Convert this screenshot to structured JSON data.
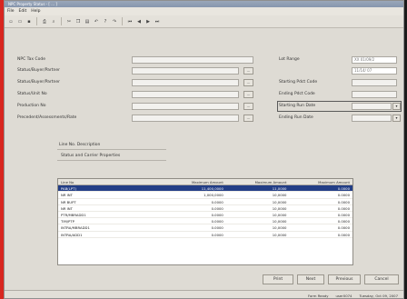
{
  "window": {
    "title": "NPC Property Status - [ ... ]"
  },
  "menu": {
    "items": [
      "File",
      "Edit",
      "Help"
    ]
  },
  "toolbar": {
    "icons": [
      "new-icon",
      "open-icon",
      "save-icon",
      "print-icon",
      "find-icon",
      "cut-icon",
      "copy-icon",
      "paste-icon",
      "undo-icon",
      "help-icon",
      "redo-icon",
      "nav-first-icon",
      "nav-prev-icon",
      "nav-next-icon",
      "nav-last-icon"
    ]
  },
  "form": {
    "left_labels": [
      "NPC Tax Code",
      "Status/Buyer/Partner",
      "Status/Buyer/Partner",
      "Status/Unit No",
      "Production No",
      "Precedent/Assessments/Rate"
    ],
    "left_values": [
      "",
      "",
      "",
      "",
      "",
      ""
    ],
    "right_labels": [
      "Lot Range",
      "Starting Pdct Code",
      "Ending Pdct Code",
      "Starting Run Date",
      "Ending Run Date"
    ],
    "right_values": [
      "XX 01/09/2",
      "11/14/ 07",
      "",
      "",
      ""
    ],
    "desc_label": "Line No. Description",
    "desc_value": "Status and Carrier Properties"
  },
  "grid": {
    "headers": [
      "Line No",
      "Maximum Amount",
      "Maximum Amount",
      "Maximum Amount"
    ],
    "rows": [
      [
        "PAB(LPT)",
        "11,400,0000",
        "11,0000",
        "0.0000"
      ],
      [
        "NR INT",
        "1,000,0000",
        "10,0000",
        "0.0000"
      ],
      [
        "NR BUPT",
        "0.0000",
        "10,0000",
        "0.0000"
      ],
      [
        "NR INT",
        "0.0000",
        "10,0000",
        "0.0000"
      ],
      [
        "PTR/MBRADD1",
        "0.0000",
        "10,0000",
        "0.0000"
      ],
      [
        "TIM/PTP",
        "0.0000",
        "10,0000",
        "0.0000"
      ],
      [
        "INTRA/MBRADD1",
        "0.0000",
        "10,0000",
        "0.0000"
      ],
      [
        "INTRA/ADD1",
        "0.0000",
        "10,0000",
        "0.0000"
      ]
    ]
  },
  "buttons": {
    "print": "Print",
    "next": "Next",
    "prev": "Previous",
    "cancel": "Cancel"
  },
  "status": {
    "mode": "Form Ready",
    "user": "user0074",
    "date": "Tuesday, Oct 09, 2007"
  },
  "colors": {
    "accent": "#233e86",
    "window_bg": "#dedbd4",
    "left_bar": "#d8261f"
  }
}
